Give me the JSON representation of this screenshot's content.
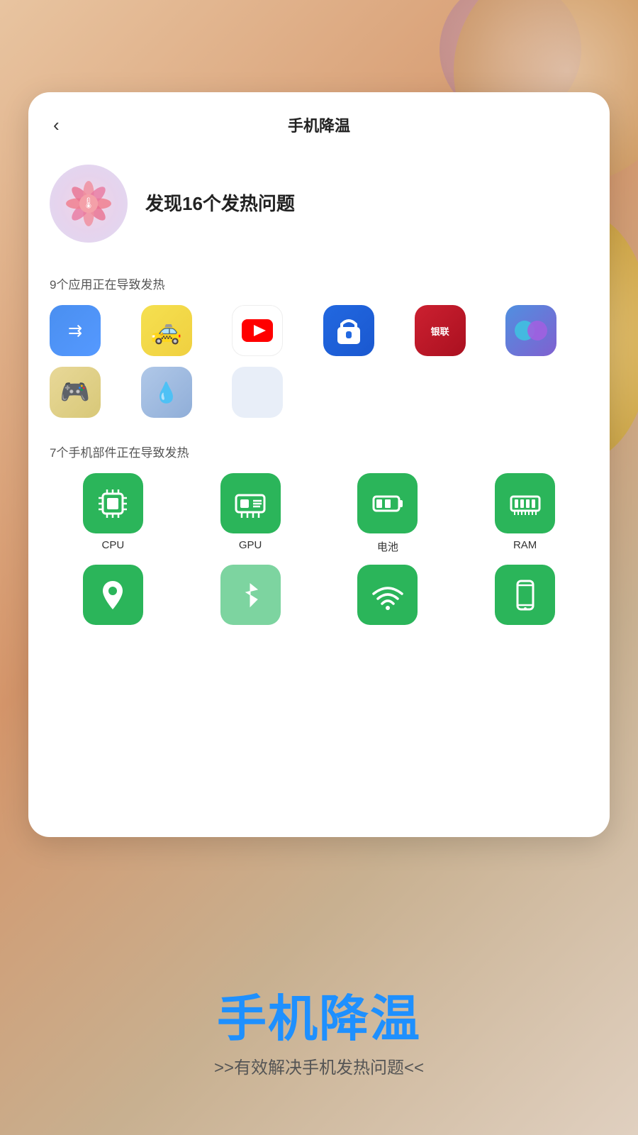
{
  "background": {
    "color_start": "#e8c4a0",
    "color_end": "#c8b090"
  },
  "card": {
    "title": "手机降温",
    "back_label": "‹",
    "fan_issue_text": "发现16个发热问题",
    "apps_section_label": "9个应用正在导致发热",
    "hw_section_label": "7个手机部件正在导致发热",
    "apps": [
      {
        "name": "transfer-app",
        "emoji": "↗",
        "color_class": "icon-transfer"
      },
      {
        "name": "taxi-app",
        "emoji": "🚕",
        "color_class": "icon-taxi"
      },
      {
        "name": "youtube-app",
        "emoji": "▶",
        "color_class": "icon-youtube"
      },
      {
        "name": "lock-app",
        "emoji": "🔒",
        "color_class": "icon-lock"
      },
      {
        "name": "unionpay-app",
        "emoji": "银",
        "color_class": "icon-unionpay"
      },
      {
        "name": "dual-app",
        "emoji": "●",
        "color_class": "icon-dual"
      },
      {
        "name": "game-app",
        "emoji": "🎮",
        "color_class": "icon-game"
      },
      {
        "name": "blue-app",
        "emoji": "💧",
        "color_class": "icon-blue-app"
      }
    ],
    "hw_components": [
      {
        "name": "cpu",
        "label": "CPU",
        "icon": "cpu",
        "light": false
      },
      {
        "name": "gpu",
        "label": "GPU",
        "icon": "gpu",
        "light": false
      },
      {
        "name": "battery",
        "label": "电池",
        "icon": "battery",
        "light": false
      },
      {
        "name": "ram",
        "label": "RAM",
        "icon": "ram",
        "light": false
      },
      {
        "name": "location",
        "label": "位置",
        "icon": "location",
        "light": false
      },
      {
        "name": "bluetooth",
        "label": "蓝牙",
        "icon": "bluetooth",
        "light": true
      },
      {
        "name": "wifi",
        "label": "WiFi",
        "icon": "wifi",
        "light": false
      },
      {
        "name": "screen",
        "label": "屏幕",
        "icon": "screen",
        "light": false
      }
    ]
  },
  "bottom": {
    "title": "手机降温",
    "subtitle": ">>有效解决手机发热问题<<"
  }
}
